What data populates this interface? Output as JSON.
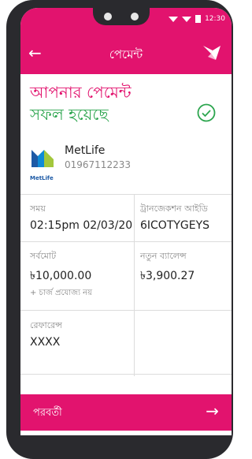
{
  "status": {
    "time": "12:30"
  },
  "appbar": {
    "title": "পেমেন্ট"
  },
  "result": {
    "line1": "আপনার পেমেন্ট",
    "line2": "সফল হয়েছে"
  },
  "payee": {
    "name": "MetLife",
    "number": "01967112233",
    "logo_text": "MetLife"
  },
  "details": {
    "time_label": "সময়",
    "time_value": "02:15pm 02/03/20",
    "trx_label": "ট্রানজেকশন আইডি",
    "trx_value": "6ICOTYGEYS",
    "total_label": "সর্বমোট",
    "total_value": "৳10,000.00",
    "total_note": "+ চার্জ প্রযোজ্য নয়",
    "balance_label": "নতুন ব্যালেন্স",
    "balance_value": "৳3,900.27",
    "ref_label": "রেফারেন্স",
    "ref_value": "XXXX"
  },
  "footer": {
    "next_label": "পরবর্তী"
  },
  "colors": {
    "brand": "#e2136e",
    "success": "#2ca54e"
  },
  "icons": [
    "back-arrow-icon",
    "bird-logo-icon",
    "check-circle-icon",
    "right-arrow-icon",
    "signal-icon",
    "battery-icon"
  ]
}
